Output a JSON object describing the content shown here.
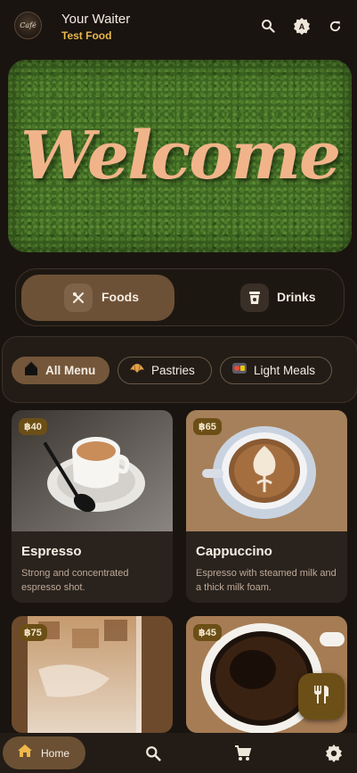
{
  "header": {
    "logo_text": "Café",
    "title": "Your Waiter",
    "subtitle": "Test Food",
    "icons": [
      "search-icon",
      "language-icon",
      "refresh-icon"
    ]
  },
  "hero": {
    "welcome_text": "Welcome"
  },
  "category_toggle": {
    "options": [
      {
        "label": "Foods",
        "icon": "utensils-icon",
        "selected": true
      },
      {
        "label": "Drinks",
        "icon": "cup-icon",
        "selected": false
      }
    ]
  },
  "chips": [
    {
      "label": "All Menu",
      "icon": "house-icon",
      "selected": true
    },
    {
      "label": "Pastries",
      "icon": "croissant-icon",
      "selected": false
    },
    {
      "label": "Light Meals",
      "icon": "bento-icon",
      "selected": false
    }
  ],
  "products": [
    {
      "name": "Espresso",
      "price": "฿40",
      "description": "Strong and concentrated espresso shot."
    },
    {
      "name": "Cappuccino",
      "price": "฿65",
      "description": "Espresso with steamed milk and a thick milk foam."
    },
    {
      "name": "",
      "price": "฿75",
      "description": ""
    },
    {
      "name": "",
      "price": "฿45",
      "description": ""
    }
  ],
  "fab": {
    "icon": "fork-knife-icon"
  },
  "bottom_nav": {
    "items": [
      {
        "label": "Home",
        "icon": "home-icon",
        "selected": true
      },
      {
        "label": "",
        "icon": "search-icon",
        "selected": false
      },
      {
        "label": "",
        "icon": "cart-icon",
        "selected": false
      },
      {
        "label": "",
        "icon": "settings-icon",
        "selected": false
      }
    ]
  },
  "colors": {
    "background": "#1a1410",
    "accent_gold": "#e8b64a",
    "selected_brown": "#6d5136",
    "price_badge": "#6b4f16"
  }
}
